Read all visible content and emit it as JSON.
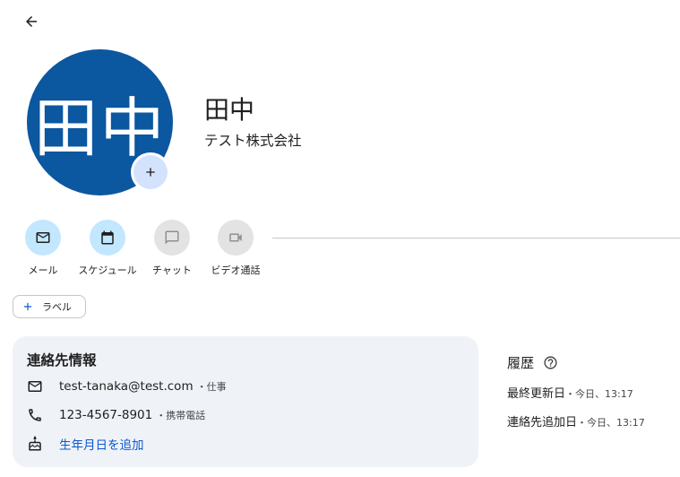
{
  "contact": {
    "avatar_text": "田中",
    "name": "田中",
    "company": "テスト株式会社"
  },
  "actions": [
    {
      "label": "メール",
      "icon": "mail-icon",
      "enabled": true
    },
    {
      "label": "スケジュール",
      "icon": "calendar-icon",
      "enabled": true
    },
    {
      "label": "チャット",
      "icon": "chat-icon",
      "enabled": false
    },
    {
      "label": "ビデオ通話",
      "icon": "videocam-icon",
      "enabled": false
    }
  ],
  "labels": {
    "add_label": "ラベル"
  },
  "contact_info": {
    "title": "連絡先情報",
    "email": "test-tanaka@test.com",
    "email_type": "・仕事",
    "phone": "123-4567-8901",
    "phone_type": "・携帯電話",
    "add_birthday": "生年月日を追加"
  },
  "history": {
    "title": "履歴",
    "last_updated_label": "最終更新日",
    "last_updated_value": "・今日、13:17",
    "added_label": "連絡先追加日",
    "added_value": "・今日、13:17"
  },
  "colors": {
    "avatar_bg": "#0b57a0",
    "action_active_bg": "#c2e7ff",
    "action_inactive_bg": "#e3e3e3",
    "card_bg": "#eff3f8",
    "link": "#0b57d0"
  }
}
